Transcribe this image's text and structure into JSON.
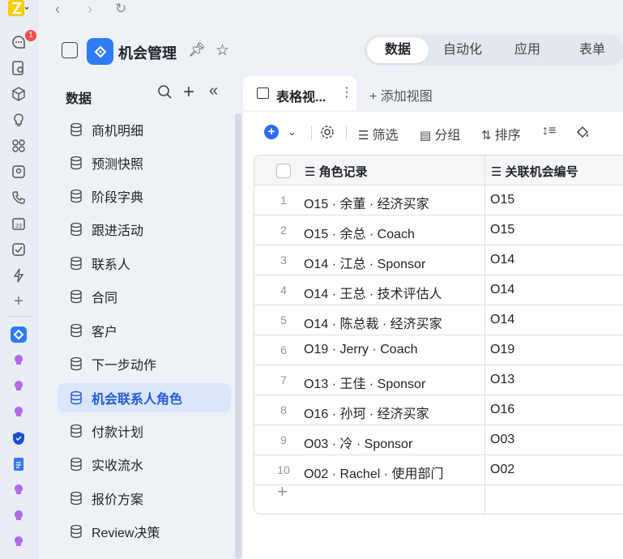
{
  "rail": {
    "badge": "1",
    "icons": [
      "chat-icon",
      "doc-search-icon",
      "cube-icon",
      "lightbulb-icon",
      "apps-grid-icon",
      "contact-card-icon",
      "phone-icon",
      "calendar-icon",
      "checkbox-icon",
      "lightning-icon",
      "add-icon",
      "app-logo-icon",
      "bot-icon",
      "bot-icon",
      "bot-icon",
      "shield-icon",
      "doc-icon",
      "bot-icon",
      "bot-icon",
      "bot-icon"
    ],
    "calendar_day": "23"
  },
  "header": {
    "app_title": "机会管理",
    "modes": [
      {
        "label": "数据",
        "active": true
      },
      {
        "label": "自动化",
        "active": false
      },
      {
        "label": "应用",
        "active": false
      },
      {
        "label": "表单",
        "active": false
      }
    ]
  },
  "sidebar": {
    "title": "数据",
    "items": [
      {
        "label": "商机明细",
        "active": false
      },
      {
        "label": "预测快照",
        "active": false
      },
      {
        "label": "阶段字典",
        "active": false
      },
      {
        "label": "跟进活动",
        "active": false
      },
      {
        "label": "联系人",
        "active": false
      },
      {
        "label": "合同",
        "active": false
      },
      {
        "label": "客户",
        "active": false
      },
      {
        "label": "下一步动作",
        "active": false
      },
      {
        "label": "机会联系人角色",
        "active": true
      },
      {
        "label": "付款计划",
        "active": false
      },
      {
        "label": "实收流水",
        "active": false
      },
      {
        "label": "报价方案",
        "active": false
      },
      {
        "label": "Review决策",
        "active": false
      }
    ]
  },
  "view": {
    "tab_label": "表格视...",
    "more": "⋮",
    "add_view": "+ 添加视图"
  },
  "toolbar": {
    "filter": "筛选",
    "group": "分组",
    "sort": "排序"
  },
  "table": {
    "columns": [
      "角色记录",
      "关联机会编号"
    ],
    "rows": [
      {
        "n": "1",
        "role": "O15 · 余董 · 经济买家",
        "opp": "O15"
      },
      {
        "n": "2",
        "role": "O15 · 余总 · Coach",
        "opp": "O15"
      },
      {
        "n": "3",
        "role": "O14 · 江总 · Sponsor",
        "opp": "O14"
      },
      {
        "n": "4",
        "role": "O14 · 王总 · 技术评估人",
        "opp": "O14"
      },
      {
        "n": "5",
        "role": "O14 · 陈总裁 · 经济买家",
        "opp": "O14"
      },
      {
        "n": "6",
        "role": "O19 · Jerry · Coach",
        "opp": "O19"
      },
      {
        "n": "7",
        "role": "O13 · 王佳 · Sponsor",
        "opp": "O13"
      },
      {
        "n": "8",
        "role": "O16 · 孙珂 · 经济买家",
        "opp": "O16"
      },
      {
        "n": "9",
        "role": "O03 · 冷 · Sponsor",
        "opp": "O03"
      },
      {
        "n": "10",
        "role": "O02 · Rachel · 使用部门",
        "opp": "O02"
      }
    ]
  }
}
